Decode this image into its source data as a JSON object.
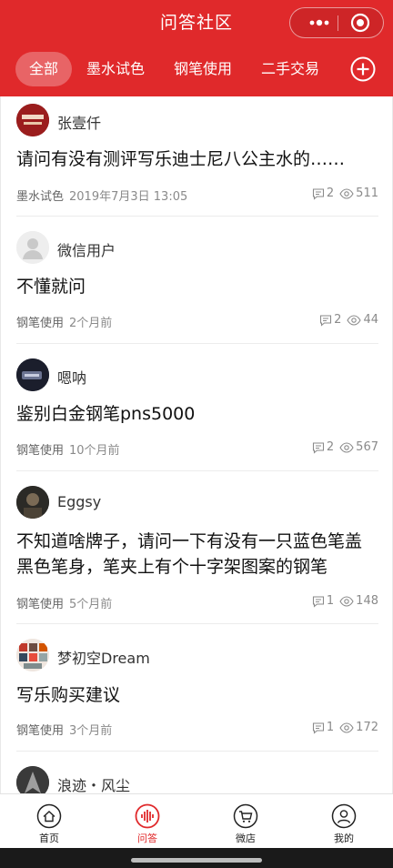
{
  "header": {
    "title": "问答社区",
    "more_icon": "more-dots-icon",
    "close_icon": "target-circle-icon",
    "accent": "#e0292b"
  },
  "tabs": [
    {
      "label": "全部",
      "active": true
    },
    {
      "label": "墨水试色",
      "active": false
    },
    {
      "label": "钢笔使用",
      "active": false
    },
    {
      "label": "二手交易",
      "active": false
    }
  ],
  "add_icon": "plus-circle-icon",
  "questions": [
    {
      "user": "张壹仟",
      "title": "请问有没有测评写乐迪士尼八公主水的……",
      "category": "墨水试色",
      "time": "2019年7月3日 13:05",
      "comments": "2",
      "views": "511"
    },
    {
      "user": "微信用户",
      "title": "不懂就问",
      "category": "钢笔使用",
      "time": "2个月前",
      "comments": "2",
      "views": "44"
    },
    {
      "user": "嗯呐",
      "title": "鉴别白金钢笔pns5000",
      "category": "钢笔使用",
      "time": "10个月前",
      "comments": "2",
      "views": "567"
    },
    {
      "user": "Eggsy",
      "title": "不知道啥牌子，请问一下有没有一只蓝色笔盖黑色笔身，笔夹上有个十字架图案的钢笔",
      "category": "钢笔使用",
      "time": "5个月前",
      "comments": "1",
      "views": "148"
    },
    {
      "user": "梦初空Dream",
      "title": "写乐购买建议",
      "category": "钢笔使用",
      "time": "3个月前",
      "comments": "1",
      "views": "172"
    },
    {
      "user": "浪迹・风尘",
      "title": "",
      "category": "",
      "time": "",
      "comments": "",
      "views": ""
    }
  ],
  "bottom_nav": [
    {
      "label": "首页",
      "icon": "home-icon",
      "active": false
    },
    {
      "label": "问答",
      "icon": "soundwave-icon",
      "active": true
    },
    {
      "label": "微店",
      "icon": "cart-icon",
      "active": false
    },
    {
      "label": "我的",
      "icon": "user-icon",
      "active": false
    }
  ]
}
